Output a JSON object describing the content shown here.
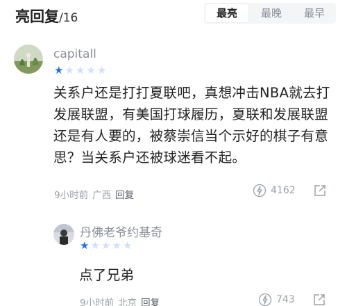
{
  "header": {
    "title": "亮回复",
    "count": "/16",
    "tabs": [
      {
        "label": "最亮",
        "active": true
      },
      {
        "label": "最晚",
        "active": false
      },
      {
        "label": "最早",
        "active": false
      }
    ]
  },
  "comments": [
    {
      "username": "capitall",
      "rating": 1,
      "rating_max": 5,
      "content": "关系户还是打打夏联吧，真想冲击NBA就去打发展联盟，有美国打球履历，夏联和发展联盟还是有人要的，被蔡崇信当个示好的棋子有意思？当关系户还被球迷看不起。",
      "time": "9小时前",
      "location": "广西",
      "reply_label": "回复",
      "likes": "4162"
    },
    {
      "username": "丹佛老爷约基奇",
      "rating": 1,
      "rating_max": 5,
      "content": "点了兄弟",
      "time": "9小时前",
      "location": "北京",
      "reply_label": "回复",
      "likes": "743"
    }
  ],
  "colors": {
    "star_active": "#1a73e8",
    "star_inactive": "#cfe0f7",
    "meta_text": "#9aa0aa"
  }
}
